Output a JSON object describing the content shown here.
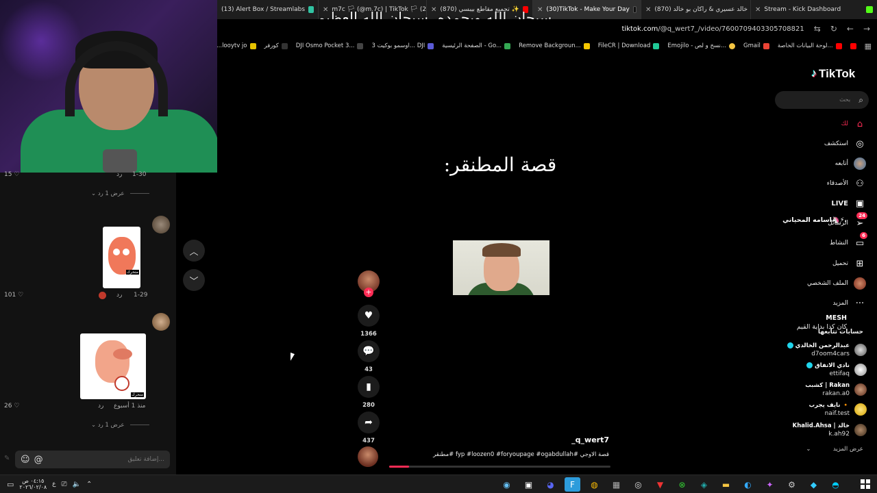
{
  "browser": {
    "tabs": [
      {
        "label": "(13) Alert Box / Streamlabs"
      },
      {
        "label": "m7c 🏳 (@m.7c) | TikTok 🏳 (29)"
      },
      {
        "label": "(870) تجميع مقاطع بيبسي ✨"
      },
      {
        "label": "(30)TikTok - Make Your Day",
        "active": true
      },
      {
        "label": "(870) خالد عسيري & راكان بو خالد"
      },
      {
        "label": "Stream - Kick Dashboard"
      }
    ],
    "url_domain": "tiktok.com",
    "url_path": "/@q_wert7_/video/7600709403305708821",
    "bookmarks": [
      "مسلسلات ...looytv jo",
      "كورفر",
      "DJI Osmo Pocket 3...",
      "اوسمو بوكيت 3... DJI",
      "الصفحة الرئيسية - Go...",
      "Remove Backgroun...",
      "FileCR | Download",
      "Emojilo - نسخ و لص...",
      "Gmail",
      "لوحة البيانات الخاصة..."
    ]
  },
  "overlay_text": "سبحان الله وبحمده، سبحان الله العظيم",
  "comments": {
    "top": {
      "likes": "15",
      "reply": "رد",
      "date": "1-30",
      "show_replies": "عرض 1 رد"
    },
    "items": [
      {
        "name": "اسامه المحياني🦄⚡.",
        "likes": "101",
        "reply": "رد",
        "date": "1-29"
      },
      {
        "name": "MESH",
        "text": "كان كذا بداية القيم",
        "likes": "26",
        "reply": "رد",
        "date": "منذ 1 أسبوع",
        "show_replies": "عرض 1 رد"
      }
    ],
    "sticker_label": "متحرك",
    "input_placeholder": "إضافة تعليق..."
  },
  "video": {
    "title": "قصة المطنقر:",
    "username": "_q_wert7",
    "caption": "قصة الاوجي #fyp #loozen0 #foryoupage #ogabdullah #مطنقر",
    "progress": 0.09,
    "actions": {
      "likes": "1366",
      "comments": "43",
      "saves": "280",
      "shares": "437"
    }
  },
  "tiktok": {
    "logo": "TikTok",
    "search_placeholder": "بحث",
    "nav": [
      {
        "label": "لك",
        "icon": "home-icon",
        "active": true
      },
      {
        "label": "استكشف",
        "icon": "compass-icon"
      },
      {
        "label": "أتابعه",
        "icon": "avatar"
      },
      {
        "label": "الأصدقاء",
        "icon": "friends-icon"
      },
      {
        "label": "LIVE",
        "icon": "live-icon"
      },
      {
        "label": "الرسائل",
        "icon": "messages-icon",
        "badge": "24"
      },
      {
        "label": "النشاط",
        "icon": "activity-icon",
        "badge": "6"
      },
      {
        "label": "تحميل",
        "icon": "upload-icon"
      },
      {
        "label": "الملف الشخصي",
        "icon": "avatar"
      },
      {
        "label": "المزيد",
        "icon": "more-icon"
      }
    ],
    "following_header": "حسابات تتابعها",
    "following": [
      {
        "name": "عبدالرحمن الخالدي",
        "handle": "d7oom4cars",
        "verified": true
      },
      {
        "name": "نادي الاتفاق",
        "handle": "ettifaq",
        "verified": true
      },
      {
        "name": "كشبب | Rakan",
        "handle": "rakan.a0"
      },
      {
        "name": "نايف يجرب 🔸",
        "handle": "naif.test"
      },
      {
        "name": "Khalid.Ahsa | خالد",
        "handle": "k.ah92"
      }
    ],
    "see_more": "عرض المزيد"
  },
  "taskbar": {
    "time": "٠٤:١٥ ص",
    "date": "٢٠٢٦/٠٢/٠٨",
    "lang": "ع"
  },
  "colors": {
    "accent": "#fe2c55",
    "cyan": "#25f4ee"
  }
}
